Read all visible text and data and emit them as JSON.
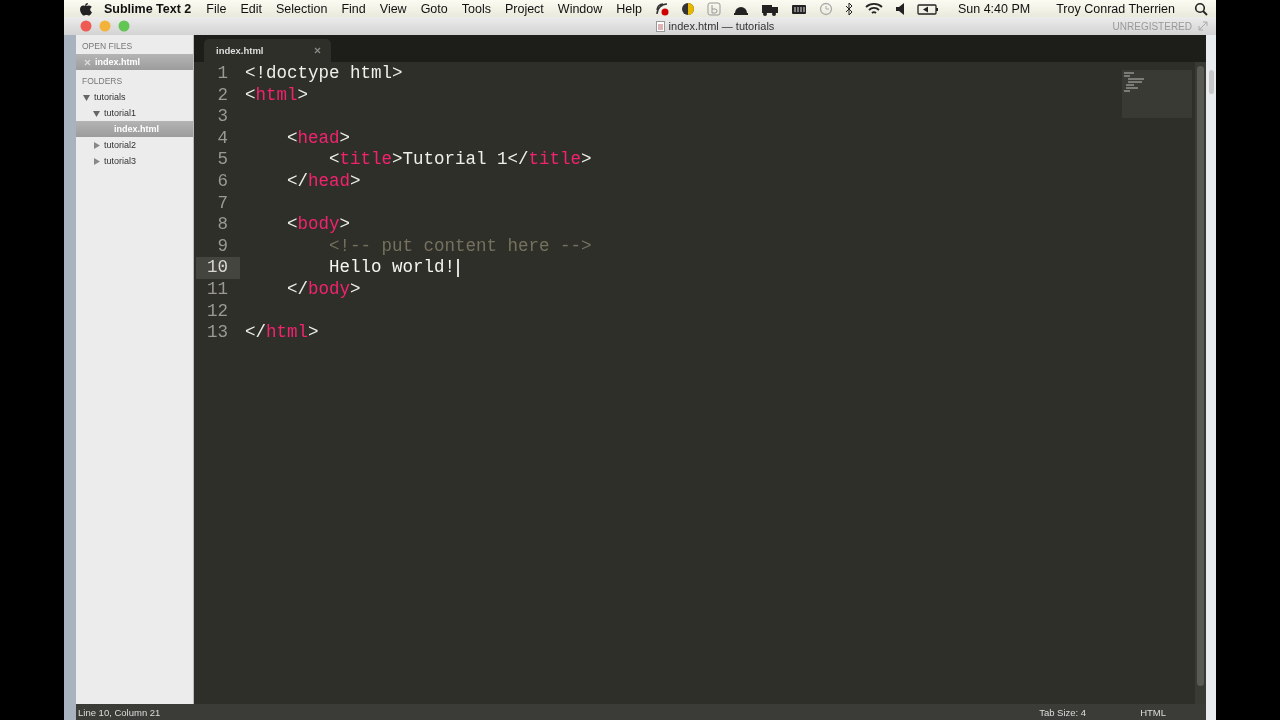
{
  "menu_bar": {
    "app_name": "Sublime Text 2",
    "menus": [
      "File",
      "Edit",
      "Selection",
      "Find",
      "View",
      "Goto",
      "Tools",
      "Project",
      "Window",
      "Help"
    ],
    "clock": "Sun 4:40 PM",
    "user": "Troy Conrad Therrien"
  },
  "window": {
    "title": "index.html — tutorials",
    "license": "UNREGISTERED"
  },
  "sidebar": {
    "open_files_header": "OPEN FILES",
    "open_files": [
      {
        "label": "index.html",
        "selected": true
      }
    ],
    "folders_header": "FOLDERS",
    "folders": [
      {
        "label": "tutorials",
        "expanded": true,
        "selected": false,
        "children": [
          {
            "label": "tutorial1",
            "expanded": true,
            "selected": false,
            "children": [
              {
                "label": "index.html",
                "kind": "file",
                "selected": true
              }
            ]
          },
          {
            "label": "tutorial2",
            "expanded": false,
            "selected": false
          },
          {
            "label": "tutorial3",
            "expanded": false,
            "selected": false
          }
        ]
      }
    ]
  },
  "tabs": [
    {
      "label": "index.html",
      "selected": true
    }
  ],
  "editor": {
    "lines": [
      {
        "number": "1",
        "current": false,
        "tokens": [
          {
            "text": "<!doctype html>",
            "kind": "punct"
          }
        ]
      },
      {
        "number": "2",
        "current": false,
        "tokens": [
          {
            "text": "<",
            "kind": "punct"
          },
          {
            "text": "html",
            "kind": "tag"
          },
          {
            "text": ">",
            "kind": "punct"
          }
        ]
      },
      {
        "number": "3",
        "current": false
      },
      {
        "number": "4",
        "current": false,
        "tokens": [
          {
            "text": "    <",
            "kind": "punct"
          },
          {
            "text": "head",
            "kind": "tag"
          },
          {
            "text": ">",
            "kind": "punct"
          }
        ]
      },
      {
        "number": "5",
        "current": false,
        "tokens": [
          {
            "text": "        <",
            "kind": "punct"
          },
          {
            "text": "title",
            "kind": "tag"
          },
          {
            "text": ">Tutorial 1</",
            "kind": "punct"
          },
          {
            "text": "title",
            "kind": "tag"
          },
          {
            "text": ">",
            "kind": "punct"
          }
        ]
      },
      {
        "number": "6",
        "current": false,
        "tokens": [
          {
            "text": "    </",
            "kind": "punct"
          },
          {
            "text": "head",
            "kind": "tag"
          },
          {
            "text": ">",
            "kind": "punct"
          }
        ]
      },
      {
        "number": "7",
        "current": false
      },
      {
        "number": "8",
        "current": false,
        "tokens": [
          {
            "text": "    <",
            "kind": "punct"
          },
          {
            "text": "body",
            "kind": "tag"
          },
          {
            "text": ">",
            "kind": "punct"
          }
        ]
      },
      {
        "number": "9",
        "current": false,
        "tokens": [
          {
            "text": "        <!-- put content here -->",
            "kind": "comment"
          }
        ]
      },
      {
        "number": "10",
        "current": true,
        "tokens": [
          {
            "text": "        Hello world!",
            "kind": "text"
          }
        ]
      },
      {
        "number": "11",
        "current": false,
        "tokens": [
          {
            "text": "    </",
            "kind": "punct"
          },
          {
            "text": "body",
            "kind": "tag"
          },
          {
            "text": ">",
            "kind": "punct"
          }
        ]
      },
      {
        "number": "12",
        "current": false
      },
      {
        "number": "13",
        "current": false,
        "tokens": [
          {
            "text": "</",
            "kind": "punct"
          },
          {
            "text": "html",
            "kind": "tag"
          },
          {
            "text": ">",
            "kind": "punct"
          }
        ]
      }
    ]
  },
  "status_bar": {
    "position": "Line 10, Column 21",
    "tab_size": "Tab Size: 4",
    "syntax": "HTML"
  }
}
